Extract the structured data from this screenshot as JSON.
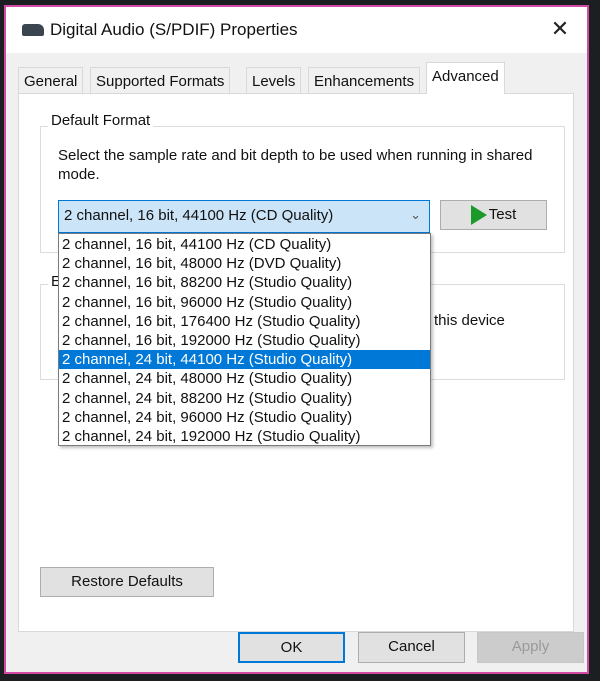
{
  "window": {
    "title": "Digital Audio (S/PDIF) Properties",
    "close_label": "✕",
    "border_color": "#d24aa4"
  },
  "tabs": [
    {
      "label": "General"
    },
    {
      "label": "Supported Formats"
    },
    {
      "label": "Levels"
    },
    {
      "label": "Enhancements"
    },
    {
      "label": "Advanced",
      "active": true
    }
  ],
  "default_format": {
    "group_label": "Default Format",
    "description": "Select the sample rate and bit depth to be used when running in shared mode.",
    "selected_value": "2 channel, 16 bit, 44100 Hz (CD Quality)",
    "test_label": "Test",
    "options": [
      "2 channel, 16 bit, 44100 Hz (CD Quality)",
      "2 channel, 16 bit, 48000 Hz (DVD Quality)",
      "2 channel, 16 bit, 88200 Hz (Studio Quality)",
      "2 channel, 16 bit, 96000 Hz (Studio Quality)",
      "2 channel, 16 bit, 176400 Hz (Studio Quality)",
      "2 channel, 16 bit, 192000 Hz (Studio Quality)",
      "2 channel, 24 bit, 44100 Hz (Studio Quality)",
      "2 channel, 24 bit, 48000 Hz (Studio Quality)",
      "2 channel, 24 bit, 88200 Hz (Studio Quality)",
      "2 channel, 24 bit, 96000 Hz (Studio Quality)",
      "2 channel, 24 bit, 192000 Hz (Studio Quality)"
    ],
    "highlighted_option": "2 channel, 24 bit, 44100 Hz (Studio Quality)"
  },
  "exclusive_mode": {
    "group_label_visible": "E",
    "partial_text": "this device"
  },
  "buttons": {
    "restore_defaults": "Restore Defaults",
    "ok": "OK",
    "cancel": "Cancel",
    "apply": "Apply"
  },
  "colors": {
    "accent": "#0078d7",
    "play": "#1c9a2c"
  }
}
